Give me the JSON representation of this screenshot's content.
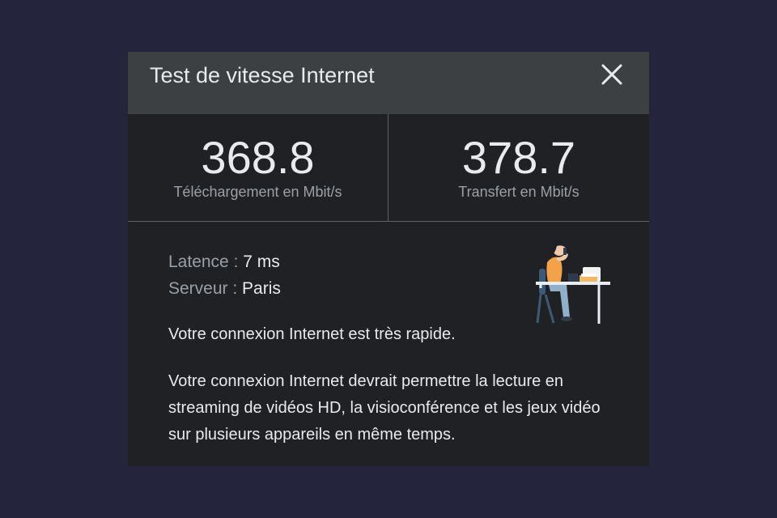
{
  "dialog": {
    "title": "Test de vitesse Internet",
    "close_icon": "close-icon"
  },
  "results": {
    "download": {
      "value": "368.8",
      "label": "Téléchargement en Mbit/s"
    },
    "upload": {
      "value": "378.7",
      "label": "Transfert en Mbit/s"
    }
  },
  "details": {
    "latency_label": "Latence : ",
    "latency_value": "7 ms",
    "server_label": "Serveur : ",
    "server_value": "Paris"
  },
  "summary": "Votre connexion Internet est très rapide.",
  "description": "Votre connexion Internet devrait permettre la lecture en streaming de vidéos HD, la visioconférence et les jeux vidéo sur plusieurs appareils en même temps.",
  "illustration_icon": "person-at-desk-with-laptop-illustration",
  "colors": {
    "page_background": "#24243c",
    "dialog_background": "#202124",
    "header_background": "#3c4043",
    "primary_text": "#e8eaed",
    "secondary_text": "#9aa0a6",
    "divider": "#5f6368"
  }
}
